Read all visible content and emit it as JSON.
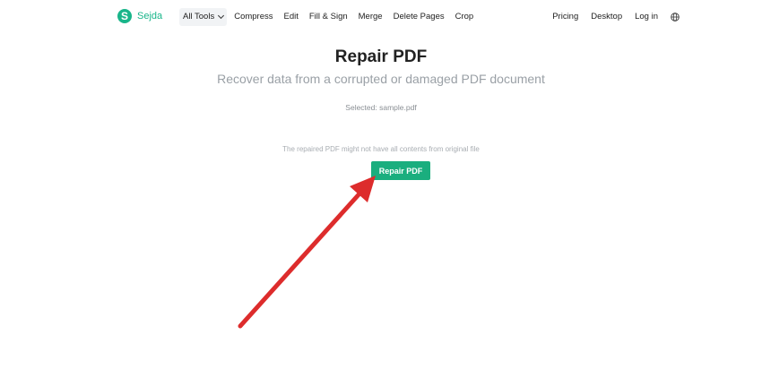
{
  "brand": {
    "name": "Sejda",
    "mark": "S",
    "color": "#19b58a"
  },
  "nav": {
    "all_tools": "All Tools",
    "items": [
      "Compress",
      "Edit",
      "Fill & Sign",
      "Merge",
      "Delete Pages",
      "Crop"
    ],
    "right": [
      "Pricing",
      "Desktop",
      "Log in"
    ],
    "language_icon": "globe-icon"
  },
  "main": {
    "title": "Repair PDF",
    "subtitle": "Recover data from a corrupted or damaged PDF document",
    "selected": "Selected: sample.pdf",
    "note": "The repaired PDF might not have all contents from original file",
    "button_label": "Repair PDF",
    "button_color": "#1aae7e"
  },
  "annotation": {
    "arrow_color": "#dd2c2c",
    "arrow_icon": "red-pointer-arrow"
  }
}
